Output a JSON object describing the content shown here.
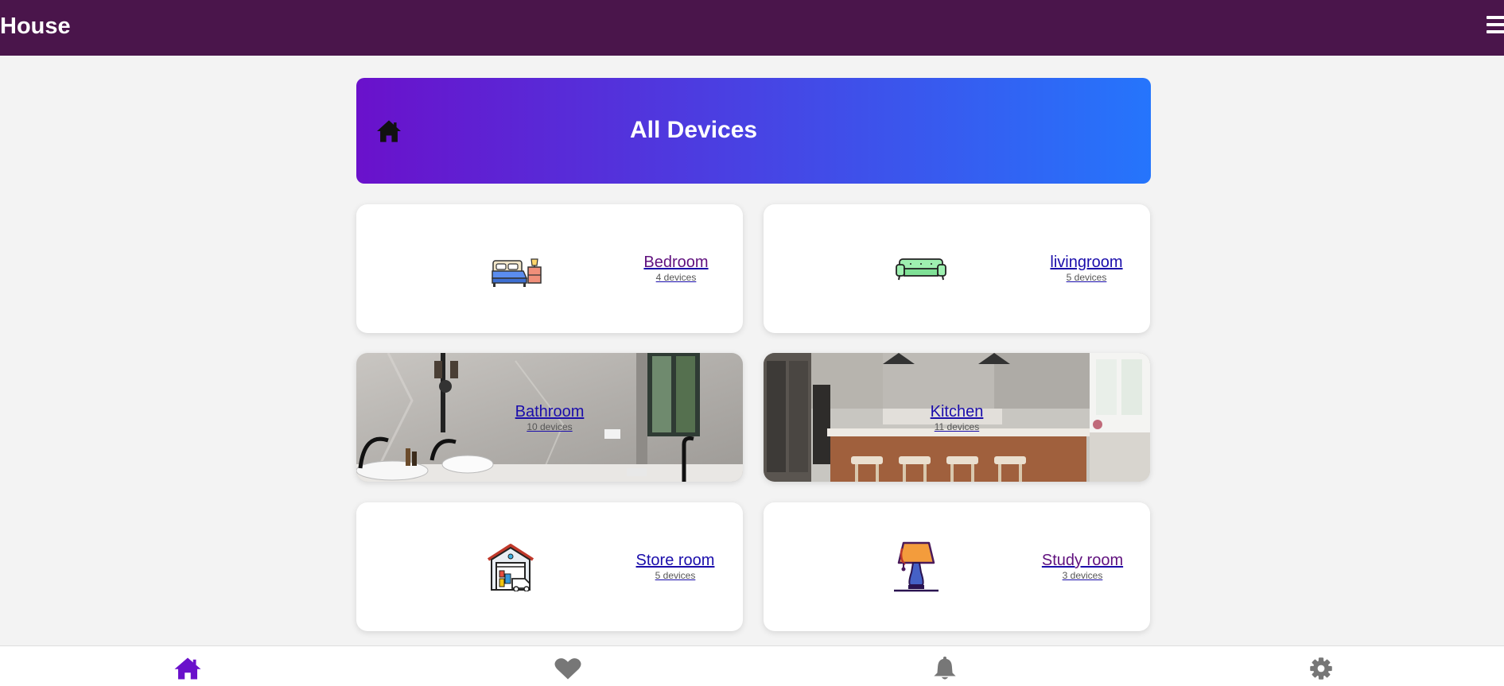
{
  "header": {
    "title": "House",
    "menu_icon": "hamburger-menu-icon"
  },
  "hero": {
    "title": "All Devices",
    "icon": "home-icon",
    "gradient": [
      "#6a11cb",
      "#2575fc"
    ]
  },
  "rooms": [
    {
      "name": "Bedroom",
      "devices": "4 devices",
      "icon": "bed-icon",
      "visited": true
    },
    {
      "name": "livingroom",
      "devices": "5 devices",
      "icon": "sofa-icon",
      "visited": false
    },
    {
      "name": "Bathroom",
      "devices": "10 devices",
      "image": "bathroom-photo",
      "visited": false
    },
    {
      "name": "Kitchen",
      "devices": "11 devices",
      "image": "kitchen-photo",
      "visited": false
    },
    {
      "name": "Store room",
      "devices": "5 devices",
      "icon": "garage-icon",
      "visited": false
    },
    {
      "name": "Study room",
      "devices": "3 devices",
      "icon": "lamp-icon",
      "visited": true
    }
  ],
  "bottom_nav": [
    {
      "icon": "home-icon",
      "active": true
    },
    {
      "icon": "heart-icon",
      "active": false
    },
    {
      "icon": "bell-icon",
      "active": false
    },
    {
      "icon": "gear-icon",
      "active": false
    }
  ],
  "colors": {
    "header_bg": "#4a154b",
    "nav_active": "#6a11cb",
    "nav_inactive": "#777777",
    "link": "#1a0dab",
    "link_visited": "#60117e"
  }
}
